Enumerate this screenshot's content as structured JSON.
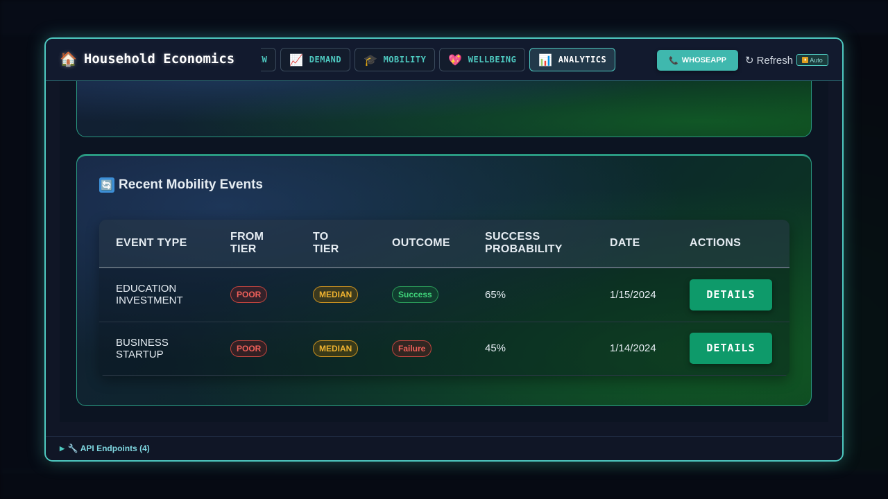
{
  "modal": {
    "title": "Household Economics",
    "title_icon": "house-icon",
    "tabs": [
      {
        "label": "ERVIEW",
        "icon": "",
        "active": false
      },
      {
        "label": "DEMAND",
        "icon": "chart-up-icon",
        "active": false
      },
      {
        "label": "MOBILITY",
        "icon": "graduation-cap-icon",
        "active": false
      },
      {
        "label": "WELLBEING",
        "icon": "heart-icon",
        "active": false
      },
      {
        "label": "ANALYTICS",
        "icon": "bar-chart-icon",
        "active": true
      }
    ],
    "whoseapp_label": "WHOSEAPP",
    "refresh_label": "Refresh",
    "auto_label": "Auto"
  },
  "mobility_events": {
    "title": "Recent Mobility Events",
    "columns": [
      "EVENT TYPE",
      "FROM TIER",
      "TO TIER",
      "OUTCOME",
      "SUCCESS PROBABILITY",
      "DATE",
      "ACTIONS"
    ],
    "rows": [
      {
        "event_type": "EDUCATION INVESTMENT",
        "from_tier": "POOR",
        "to_tier": "MEDIAN",
        "outcome": "Success",
        "success_probability": "65%",
        "date": "1/15/2024",
        "action": "DETAILS"
      },
      {
        "event_type": "BUSINESS STARTUP",
        "from_tier": "POOR",
        "to_tier": "MEDIAN",
        "outcome": "Failure",
        "success_probability": "45%",
        "date": "1/14/2024",
        "action": "DETAILS"
      }
    ]
  },
  "footer": {
    "api_endpoints_label": "🔧 API Endpoints (4)"
  },
  "colors": {
    "accent": "#4ec9c0",
    "poor": "#f0605a",
    "median": "#f0b430",
    "success": "#3fd47a",
    "details_button": "#0e9a6a"
  }
}
